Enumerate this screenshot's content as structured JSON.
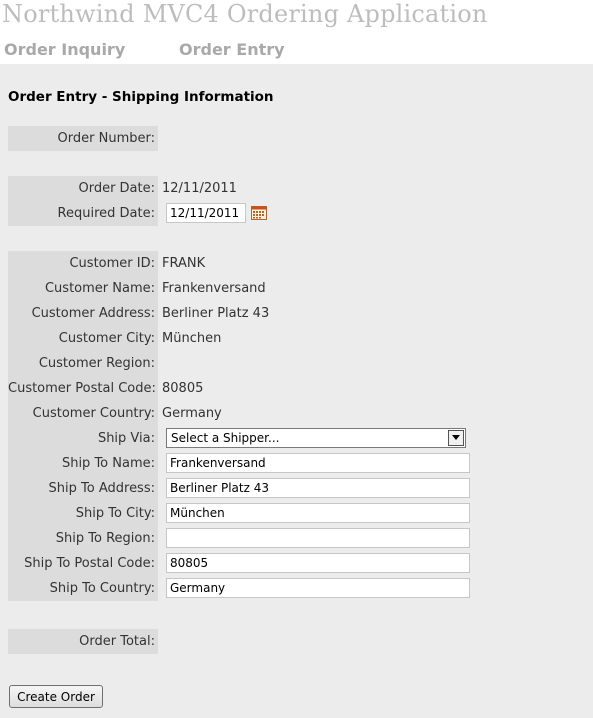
{
  "app_title": "Northwind MVC4 Ordering Application",
  "nav": {
    "order_inquiry": "Order Inquiry",
    "order_entry": "Order Entry"
  },
  "section_title": "Order Entry - Shipping Information",
  "order_number": {
    "label": "Order Number:",
    "value": ""
  },
  "order_date": {
    "label": "Order Date:",
    "value": "12/11/2011"
  },
  "required_date": {
    "label": "Required Date:",
    "value": "12/11/2011",
    "icon": "calendar-icon"
  },
  "customer": {
    "id": {
      "label": "Customer ID:",
      "value": "FRANK"
    },
    "name": {
      "label": "Customer Name:",
      "value": "Frankenversand"
    },
    "address": {
      "label": "Customer Address:",
      "value": "Berliner Platz 43"
    },
    "city": {
      "label": "Customer City:",
      "value": "München"
    },
    "region": {
      "label": "Customer Region:",
      "value": ""
    },
    "postal_code": {
      "label": "Customer Postal Code:",
      "value": "80805"
    },
    "country": {
      "label": "Customer Country:",
      "value": "Germany"
    }
  },
  "ship": {
    "via": {
      "label": "Ship Via:",
      "selected": "Select a Shipper..."
    },
    "name": {
      "label": "Ship To Name:",
      "value": "Frankenversand"
    },
    "address": {
      "label": "Ship To Address:",
      "value": "Berliner Platz 43"
    },
    "city": {
      "label": "Ship To City:",
      "value": "München"
    },
    "region": {
      "label": "Ship To Region:",
      "value": ""
    },
    "postal_code": {
      "label": "Ship To Postal Code:",
      "value": "80805"
    },
    "country": {
      "label": "Ship To Country:",
      "value": "Germany"
    }
  },
  "order_total": {
    "label": "Order Total:",
    "value": ""
  },
  "create_order_label": "Create Order",
  "colors": {
    "page_background": "#ececec",
    "label_background": "#dcdcdc",
    "title_gray": "#bdbdbd",
    "nav_gray": "#a9a9a9"
  }
}
